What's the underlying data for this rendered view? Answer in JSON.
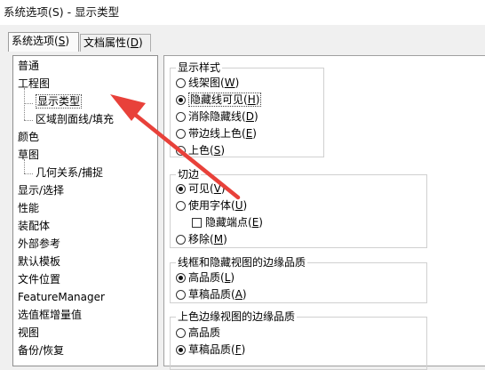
{
  "window": {
    "title": "系统选项(S) - 显示类型"
  },
  "tabs": [
    {
      "label": "系统选项",
      "mn": "S"
    },
    {
      "label": "文档属性",
      "mn": "D"
    }
  ],
  "tree": {
    "items": [
      {
        "label": "普通"
      },
      {
        "label": "工程图"
      },
      {
        "label": "显示类型"
      },
      {
        "label": "区域剖面线/填充"
      },
      {
        "label": "颜色"
      },
      {
        "label": "草图"
      },
      {
        "label": "几何关系/捕捉"
      },
      {
        "label": "显示/选择"
      },
      {
        "label": "性能"
      },
      {
        "label": "装配体"
      },
      {
        "label": "外部参考"
      },
      {
        "label": "默认模板"
      },
      {
        "label": "文件位置"
      },
      {
        "label": "FeatureManager"
      },
      {
        "label": "选值框增量值"
      },
      {
        "label": "视图"
      },
      {
        "label": "备份/恢复"
      }
    ]
  },
  "groups": {
    "display_style": {
      "label": "显示样式",
      "options": [
        {
          "label": "线架图",
          "mn": "W",
          "checked": false
        },
        {
          "label": "隐藏线可见",
          "mn": "H",
          "checked": true
        },
        {
          "label": "消除隐藏线",
          "mn": "D",
          "checked": false
        },
        {
          "label": "带边线上色",
          "mn": "E",
          "checked": false
        },
        {
          "label": "上色",
          "mn": "S",
          "checked": false
        }
      ]
    },
    "tangent": {
      "label": "切边",
      "options": [
        {
          "label": "可见",
          "mn": "V",
          "checked": true
        },
        {
          "label": "使用字体",
          "mn": "U",
          "checked": false
        },
        {
          "label": "隐藏端点",
          "mn": "E",
          "checked": false
        },
        {
          "label": "移除",
          "mn": "M",
          "checked": false
        }
      ]
    },
    "wireframe_quality": {
      "label": "线框和隐藏视图的边缘品质",
      "options": [
        {
          "label": "高品质",
          "mn": "L",
          "checked": true
        },
        {
          "label": "草稿品质",
          "mn": "A",
          "checked": false
        }
      ]
    },
    "shaded_quality": {
      "label": "上色边缘视图的边缘品质",
      "options": [
        {
          "label": "高品质",
          "mn": "",
          "checked": false
        },
        {
          "label": "草稿品质",
          "mn": "F",
          "checked": true
        }
      ]
    }
  },
  "colors": {
    "annotation_arrow": "#e8413a"
  }
}
